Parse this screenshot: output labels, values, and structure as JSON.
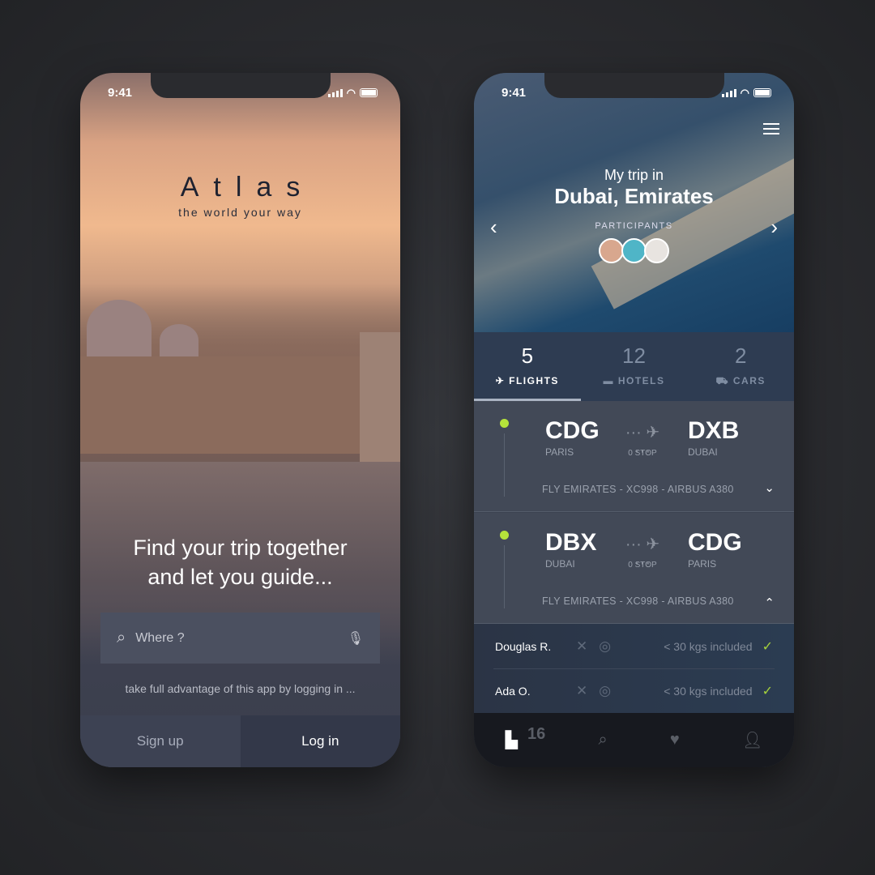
{
  "status": {
    "time": "9:41"
  },
  "login_screen": {
    "app_name": "Atlas",
    "tagline": "the world your way",
    "headline_1": "Find your trip together",
    "headline_2": "and let you guide...",
    "search": {
      "placeholder": "Where ?",
      "icon": "search-icon",
      "mic_icon": "microphone-icon"
    },
    "hint": "take full advantage of this app by logging in ...",
    "signup": "Sign up",
    "login": "Log in"
  },
  "trip_screen": {
    "title_1": "My trip in",
    "title_2": "Dubai, Emirates",
    "participants_label": "PARTICIPANTS",
    "tabs": [
      {
        "count": "5",
        "label": "FLIGHTS",
        "icon": "plane-takeoff-icon",
        "active": true
      },
      {
        "count": "12",
        "label": "HOTELS",
        "icon": "bed-icon",
        "active": false
      },
      {
        "count": "2",
        "label": "CARS",
        "icon": "car-icon",
        "active": false
      }
    ],
    "flights": [
      {
        "from": "CDG",
        "from_city": "PARIS",
        "to": "DXB",
        "to_city": "DUBAI",
        "stops": "0 STOP",
        "info": "FLY EMIRATES - XC998 - AIRBUS A380",
        "expanded": false
      },
      {
        "from": "DBX",
        "from_city": "DUBAI",
        "to": "CDG",
        "to_city": "PARIS",
        "stops": "0 STOP",
        "info": "FLY EMIRATES - XC998 - AIRBUS A380",
        "expanded": true
      }
    ],
    "passengers": [
      {
        "name": "Douglas R.",
        "baggage": "< 30 kgs included"
      },
      {
        "name": "Ada O.",
        "baggage": "< 30 kgs included"
      }
    ],
    "nav": {
      "trips_badge": "16"
    },
    "accent": "#b5e33b"
  }
}
